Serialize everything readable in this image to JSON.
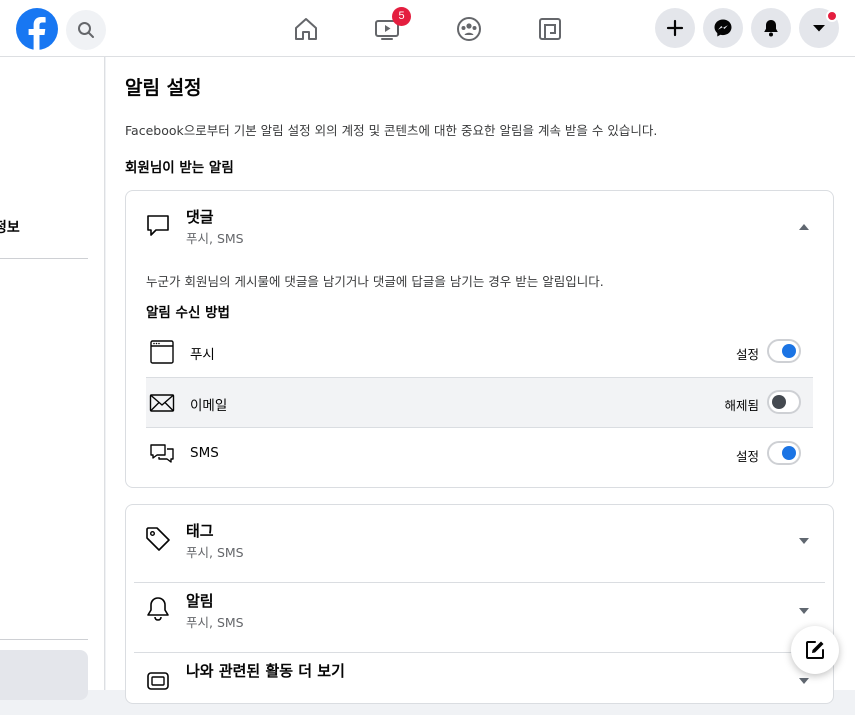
{
  "topbar": {
    "logo_icon": "facebook-logo",
    "search_icon": "search-icon",
    "nav": [
      {
        "name": "home",
        "icon": "home-icon"
      },
      {
        "name": "watch",
        "icon": "video-icon",
        "badge": "5"
      },
      {
        "name": "groups",
        "icon": "groups-icon"
      },
      {
        "name": "gaming",
        "icon": "gaming-icon"
      }
    ],
    "right": [
      "plus-icon",
      "messenger-icon",
      "bell-icon",
      "account-menu-icon"
    ],
    "brand_color": "#1877f2",
    "badge_color": "#e41e3f"
  },
  "left": {
    "partial_label": "정보"
  },
  "page": {
    "title": "알림 설정",
    "description": "Facebook으로부터 기본 알림 설정 외의 계정 및 콘텐츠에 대한 중요한 알림을 계속 받을 수 있습니다.",
    "section_heading": "회원님이 받는 알림"
  },
  "expanded_category": {
    "title": "댓글",
    "subtitle": "푸시, SMS",
    "description": "누군가 회원님의 게시물에 댓글을 남기거나 댓글에 답글을 남기는 경우 받는 알림입니다.",
    "methods_heading": "알림 수신 방법",
    "methods": [
      {
        "label": "푸시",
        "status": "설정",
        "on": true,
        "icon": "browser-window-icon"
      },
      {
        "label": "이메일",
        "status": "해제됨",
        "on": false,
        "icon": "envelope-icon"
      },
      {
        "label": "SMS",
        "status": "설정",
        "on": true,
        "icon": "sms-icon"
      }
    ]
  },
  "categories": [
    {
      "title": "태그",
      "subtitle": "푸시, SMS",
      "icon": "tag-icon"
    },
    {
      "title": "알림",
      "subtitle": "푸시, SMS",
      "icon": "bell-icon"
    },
    {
      "title": "나와 관련된 활동 더 보기",
      "subtitle": "",
      "icon": "activity-icon"
    }
  ],
  "toggle_on_color": "#1b74e4"
}
